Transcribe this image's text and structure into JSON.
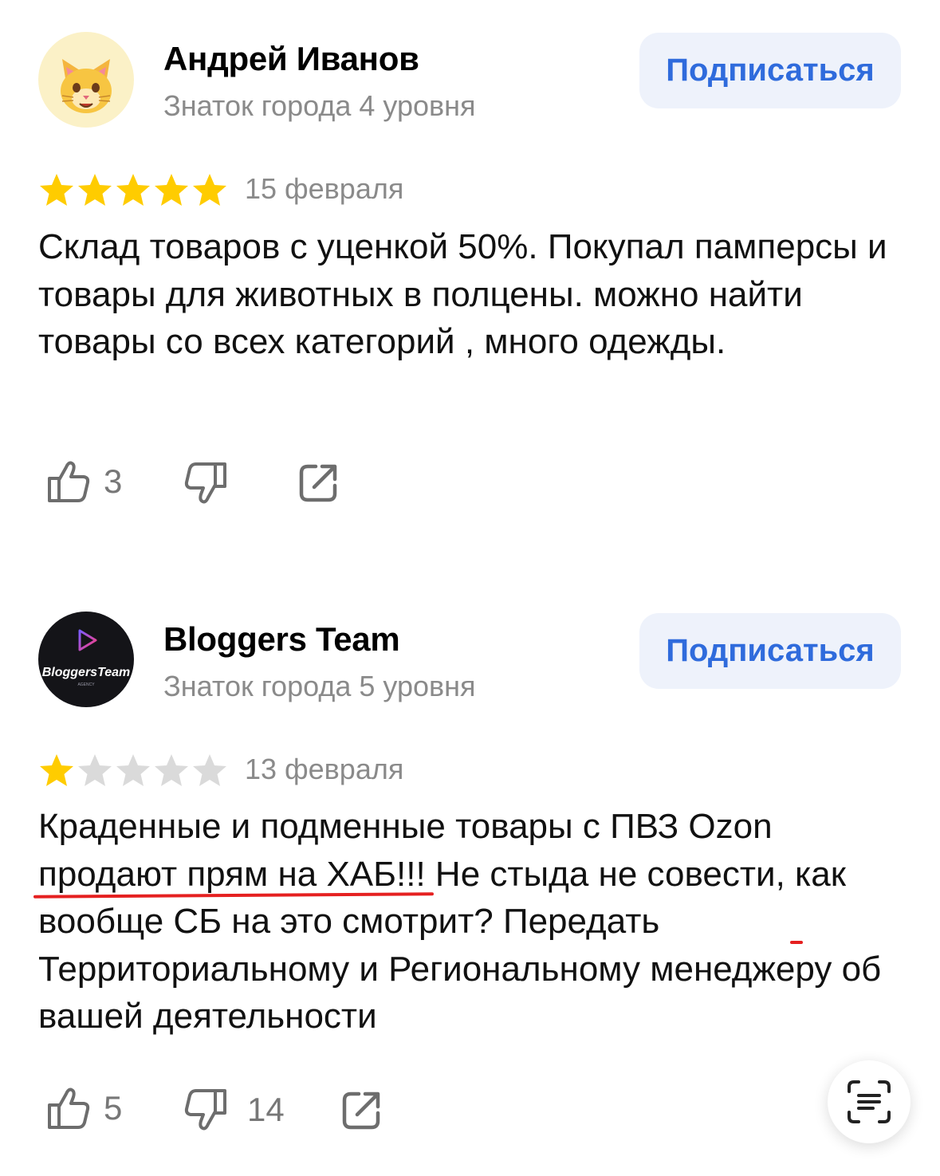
{
  "reviews": [
    {
      "author": "Андрей Иванов",
      "level": "Знаток города 4 уровня",
      "subscribe_label": "Подписаться",
      "rating": 5,
      "date": "15 февраля",
      "text": "Склад товаров с уценкой 50%. Покупал памперсы и товары для животных в полцены. можно найти товары со всех категорий , много одежды.",
      "likes": "3",
      "dislikes": "",
      "avatar_icon": "cat-face-emoji-icon"
    },
    {
      "author": "Bloggers Team",
      "level": "Знаток города 5 уровня",
      "subscribe_label": "Подписаться",
      "rating": 1,
      "date": "13 февраля",
      "text_parts": {
        "p1": "Краденные и подменные товары с ПВЗ Ozon ",
        "hl1": "продают прям на ХАБ!!!",
        "p2": " Не стыда не совести, ",
        "hl2": "как вообще СБ на это смотрит?",
        "p3": " Передать Территориальному и Региональному менеджеру об вашей деятельности"
      },
      "likes": "5",
      "dislikes": "14",
      "avatar_logo_text": "BloggersTeam",
      "avatar_logo_subtext": "AGENCY"
    }
  ],
  "colors": {
    "star_filled": "#FFCC00",
    "star_empty": "#DADADA",
    "accent": "#2F6BDC",
    "highlight_underline": "#E52020"
  }
}
